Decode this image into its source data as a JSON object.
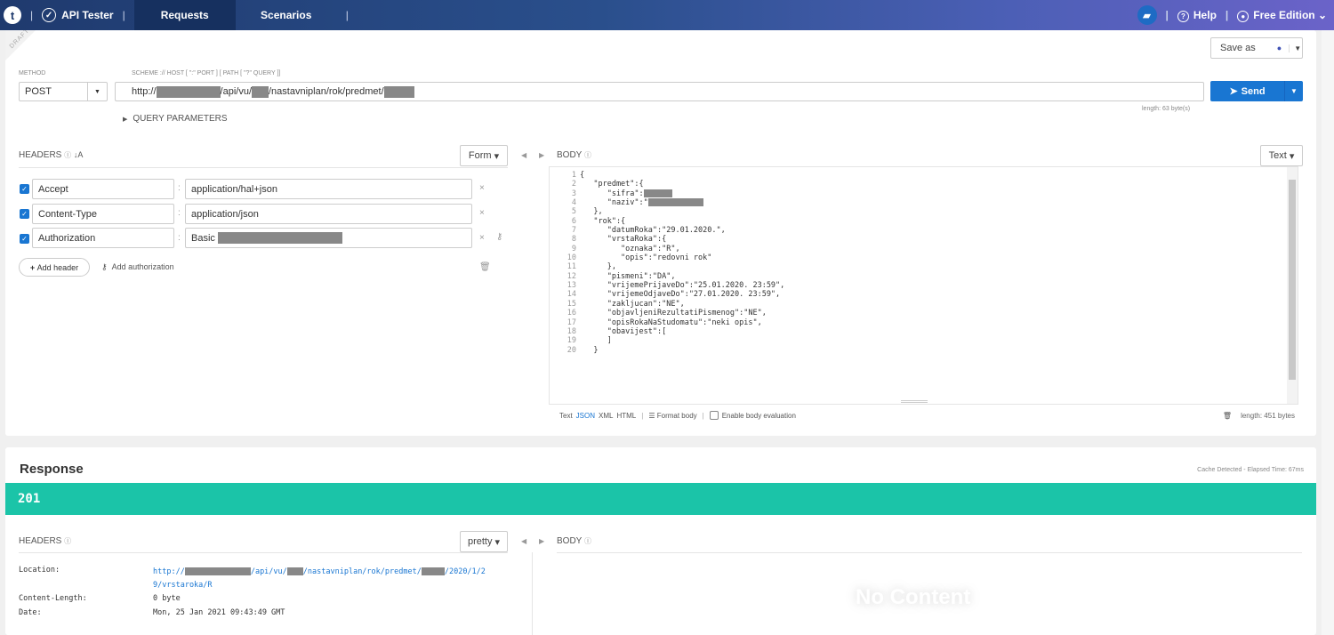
{
  "topbar": {
    "logo_letter": "t",
    "app_name": "API Tester",
    "tabs": [
      {
        "label": "Requests"
      },
      {
        "label": "Scenarios"
      }
    ],
    "help_label": "Help",
    "edition_label": "Free Edition"
  },
  "request": {
    "draft_label": "DRAFT",
    "save_as_label": "Save as",
    "method_label": "METHOD",
    "method_value": "POST",
    "url_hint": "SCHEME :// HOST [ \":\" PORT ] [ PATH [ \"?\" QUERY ]]",
    "url_parts": [
      "http://",
      "/api/vu/",
      "/nastavniplan/rok/predmet/"
    ],
    "send_label": "Send",
    "length_label": "length: 63 byte(s)",
    "query_params_label": "QUERY PARAMETERS",
    "headers_label": "HEADERS",
    "form_label": "Form",
    "headers": [
      {
        "name": "Accept",
        "value": "application/hal+json"
      },
      {
        "name": "Content-Type",
        "value": "application/json"
      },
      {
        "name": "Authorization",
        "value": "Basic"
      }
    ],
    "add_header_label": "Add header",
    "add_auth_label": "Add authorization",
    "body_label": "BODY",
    "body_format_label": "Text",
    "body_lines": [
      "{",
      "   \"predmet\":{",
      "      \"sifra\":",
      "      \"naziv\":\"",
      "   },",
      "   \"rok\":{",
      "      \"datumRoka\":\"29.01.2020.\",",
      "      \"vrstaRoka\":{",
      "         \"oznaka\":\"R\",",
      "         \"opis\":\"redovni rok\"",
      "      },",
      "      \"pismeni\":\"DA\",",
      "      \"vrijemePrijaveDo\":\"25.01.2020. 23:59\",",
      "      \"vrijemeOdjaveDo\":\"27.01.2020. 23:59\",",
      "      \"zakljucan\":\"NE\",",
      "      \"objavljeniRezultatiPismenog\":\"NE\",",
      "      \"opisRokaNaStudomatu\":\"neki opis\",",
      "      \"obavijest\":[",
      "      ]",
      "   }"
    ],
    "body_modes": [
      "Text",
      "JSON",
      "XML",
      "HTML"
    ],
    "format_body_label": "Format body",
    "enable_eval_label": "Enable body evaluation",
    "body_length_label": "length: 451 bytes"
  },
  "response": {
    "title": "Response",
    "cache_label": "Cache Detected - Elapsed Time: 67ms",
    "status_code": "201",
    "headers_label": "HEADERS",
    "pretty_label": "pretty",
    "body_label": "BODY",
    "headers": [
      {
        "name": "Location:",
        "value_parts": [
          "http://",
          "/api/vu/",
          "/nastavniplan/rok/predmet/",
          "/2020/1/2",
          "9/vrstaroka/R"
        ]
      },
      {
        "name": "Content-Length:",
        "value": "0 byte"
      },
      {
        "name": "Date:",
        "value": "Mon, 25 Jan 2021 09:43:49 GMT"
      }
    ],
    "no_content_label": "No Content"
  },
  "colors": {
    "accent": "#1976d2",
    "status_success": "#1bc4a8",
    "topbar": "#1f3a6e"
  }
}
